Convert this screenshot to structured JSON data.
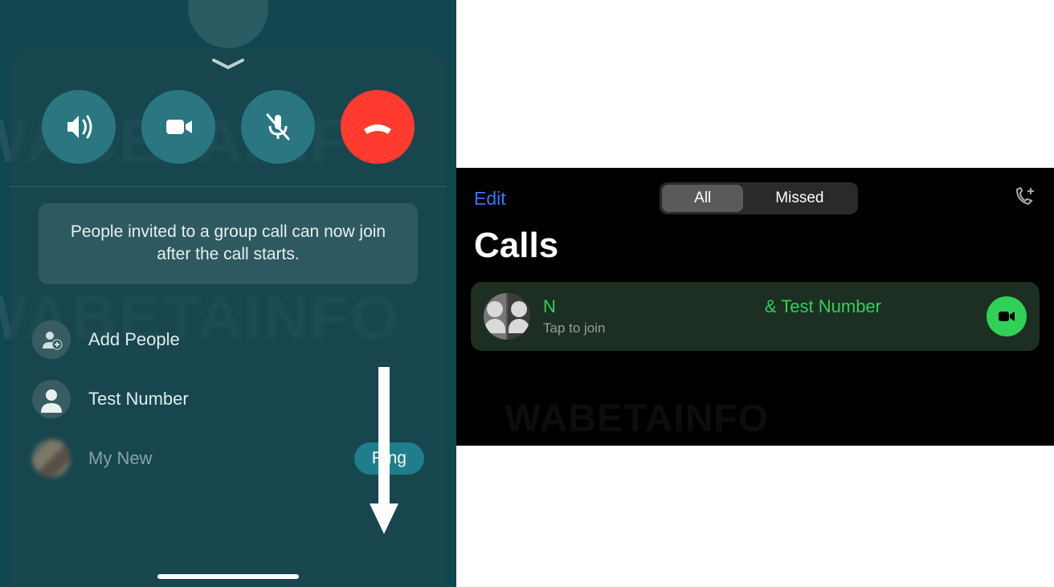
{
  "left": {
    "info_text": "People invited to a group call can now join after the call starts.",
    "add_people_label": "Add People",
    "participants": [
      {
        "name": "Test Number",
        "ringable": false
      },
      {
        "name": "My New",
        "ringable": true
      }
    ],
    "ring_label": "Ring",
    "buttons": {
      "speaker": "speaker-icon",
      "video": "video-icon",
      "mute": "mic-off-icon",
      "end": "hangup-icon"
    },
    "watermark": "WABETAINFO"
  },
  "right": {
    "edit_label": "Edit",
    "tabs": {
      "all": "All",
      "missed": "Missed"
    },
    "title": "Calls",
    "row": {
      "name_part1": "N",
      "name_part2": "& Test Number",
      "subtitle": "Tap to join"
    },
    "watermark": "WABETAINFO"
  }
}
